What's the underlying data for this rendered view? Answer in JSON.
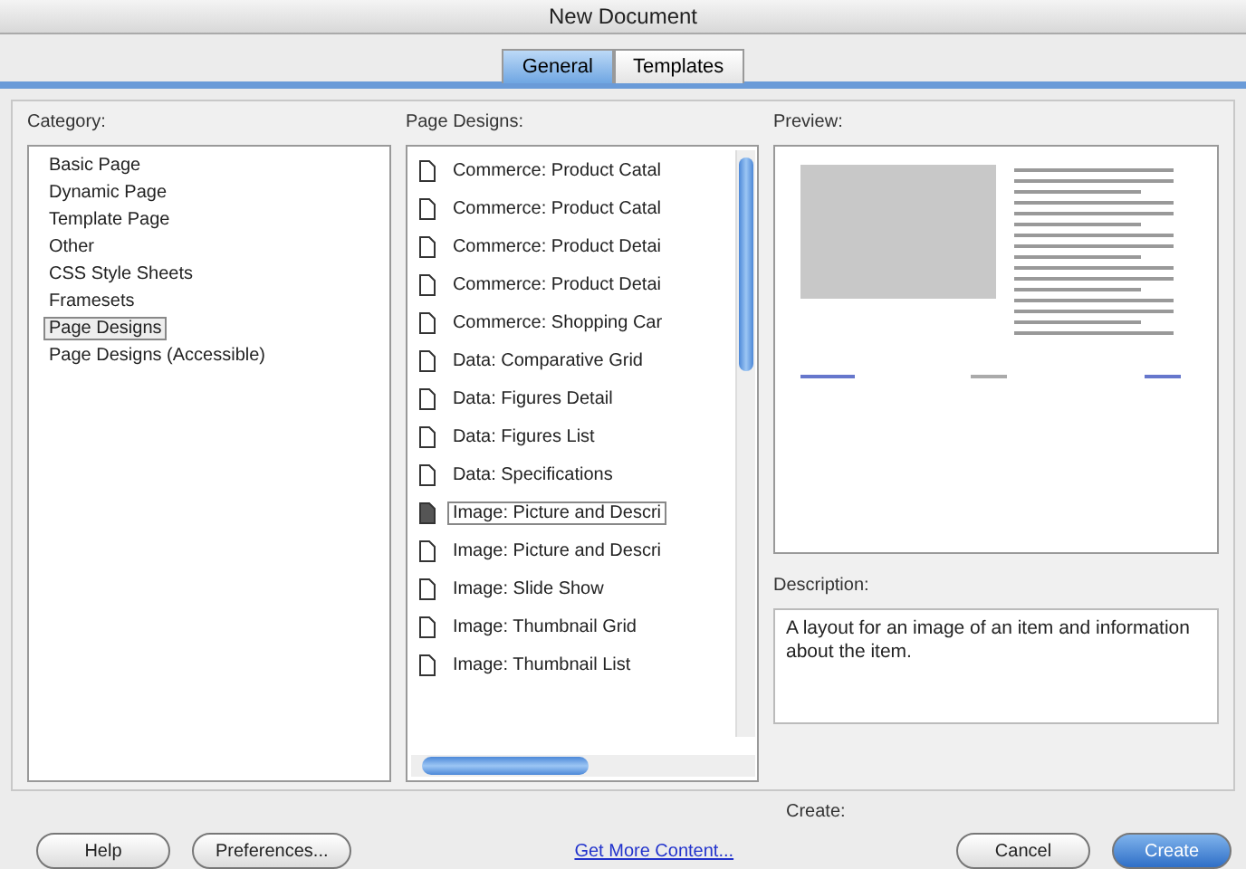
{
  "window": {
    "title": "New Document"
  },
  "tabs": [
    {
      "label": "General",
      "selected": true
    },
    {
      "label": "Templates",
      "selected": false
    }
  ],
  "category": {
    "label": "Category:",
    "items": [
      {
        "label": "Basic Page",
        "selected": false
      },
      {
        "label": "Dynamic Page",
        "selected": false
      },
      {
        "label": "Template Page",
        "selected": false
      },
      {
        "label": "Other",
        "selected": false
      },
      {
        "label": "CSS Style Sheets",
        "selected": false
      },
      {
        "label": "Framesets",
        "selected": false
      },
      {
        "label": "Page Designs",
        "selected": true
      },
      {
        "label": "Page Designs (Accessible)",
        "selected": false
      }
    ]
  },
  "page_designs": {
    "label": "Page Designs:",
    "items": [
      {
        "label": "Commerce: Product Catal",
        "selected": false
      },
      {
        "label": "Commerce: Product Catal",
        "selected": false
      },
      {
        "label": "Commerce: Product Detai",
        "selected": false
      },
      {
        "label": "Commerce: Product Detai",
        "selected": false
      },
      {
        "label": "Commerce: Shopping Car",
        "selected": false
      },
      {
        "label": "Data: Comparative Grid",
        "selected": false
      },
      {
        "label": "Data: Figures Detail",
        "selected": false
      },
      {
        "label": "Data: Figures List",
        "selected": false
      },
      {
        "label": "Data: Specifications",
        "selected": false
      },
      {
        "label": "Image: Picture and Descri",
        "selected": true
      },
      {
        "label": "Image: Picture and Descri",
        "selected": false
      },
      {
        "label": "Image: Slide Show",
        "selected": false
      },
      {
        "label": "Image: Thumbnail Grid",
        "selected": false
      },
      {
        "label": "Image: Thumbnail List",
        "selected": false
      }
    ]
  },
  "preview": {
    "label": "Preview:"
  },
  "description": {
    "label": "Description:",
    "text": "A layout for an image of an item and information about the item."
  },
  "create_label": "Create:",
  "buttons": [
    {
      "label": "Help",
      "kind": "plain"
    },
    {
      "label": "Preferences...",
      "kind": "plain"
    },
    {
      "label": "Get More Content...",
      "kind": "link"
    },
    {
      "label": "Cancel",
      "kind": "plain"
    },
    {
      "label": "Create",
      "kind": "default"
    }
  ]
}
